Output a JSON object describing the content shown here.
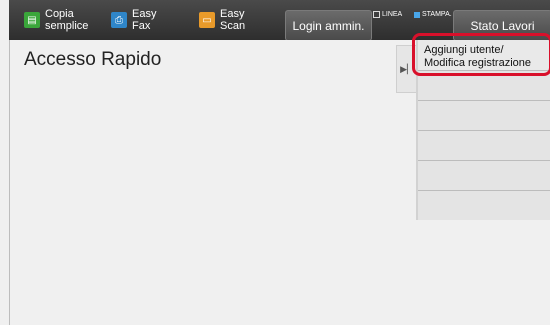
{
  "topbar": {
    "shortcuts": [
      {
        "label": "Copia\nsemplice",
        "icon": "copy-icon"
      },
      {
        "label": "Easy\nFax",
        "icon": "fax-icon"
      },
      {
        "label": "Easy\nScan",
        "icon": "scan-icon"
      }
    ],
    "login_label": "Login ammin.",
    "status_label": "Stato Lavori",
    "indicator_line": "LINEA",
    "indicator_print": "STAMPA."
  },
  "main": {
    "title": "Accesso Rapido",
    "side_panel": {
      "items": [
        {
          "label": "Aggiungi utente/\nModifica registrazione"
        }
      ]
    }
  },
  "colors": {
    "highlight": "#d9102b",
    "print_indicator": "#49a6e9"
  }
}
